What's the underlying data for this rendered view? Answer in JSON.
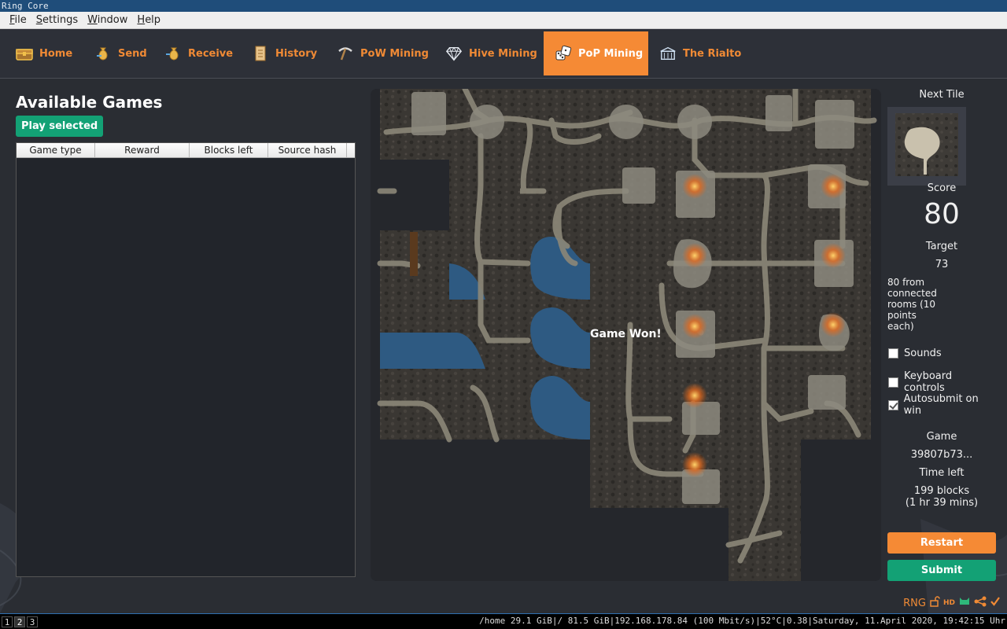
{
  "window": {
    "title": "Ring Core"
  },
  "menu": [
    {
      "label": "File",
      "underline": "F",
      "rest": "ile"
    },
    {
      "label": "Settings",
      "underline": "S",
      "rest": "ettings"
    },
    {
      "label": "Window",
      "underline": "W",
      "rest": "indow"
    },
    {
      "label": "Help",
      "underline": "H",
      "rest": "elp"
    }
  ],
  "tabs": [
    {
      "label": "Home",
      "icon": "treasure-chest-icon"
    },
    {
      "label": "Send",
      "icon": "money-bag-send-icon"
    },
    {
      "label": "Receive",
      "icon": "money-bag-receive-icon"
    },
    {
      "label": "History",
      "icon": "scroll-icon"
    },
    {
      "label": "PoW Mining",
      "icon": "pickaxe-icon"
    },
    {
      "label": "Hive Mining",
      "icon": "diamond-icon"
    },
    {
      "label": "PoP Mining",
      "icon": "dice-icon",
      "active": true
    },
    {
      "label": "The Rialto",
      "icon": "market-icon"
    }
  ],
  "games": {
    "title": "Available Games",
    "play_label": "Play selected",
    "columns": [
      "Game type",
      "Reward",
      "Blocks left",
      "Source hash"
    ],
    "rows": []
  },
  "board": {
    "status": "Game Won!"
  },
  "side": {
    "next_tile_label": "Next Tile",
    "score_label": "Score",
    "score": "80",
    "target_label": "Target",
    "target": "73",
    "description": "80 from connected rooms (10 points each)",
    "options": [
      {
        "label": "Sounds",
        "checked": false
      },
      {
        "label": "Keyboard controls",
        "checked": false
      },
      {
        "label": "Autosubmit on win",
        "checked": true
      }
    ],
    "game_label": "Game",
    "game_hash": "39807b73...",
    "time_left_label": "Time left",
    "blocks_left": "199 blocks",
    "time_left": "(1 hr 39 mins)",
    "restart_label": "Restart",
    "submit_label": "Submit"
  },
  "status": {
    "ticker": "RNG",
    "hd_label": "HD"
  },
  "taskbar": {
    "workspaces": [
      "1",
      "2",
      "3"
    ],
    "active_workspace": "2",
    "system": "/home 29.1 GiB|/ 81.5 GiB|192.168.178.84 (100 Mbit/s)|52°C|0.38|Saturday, 11.April 2020, 19:42:15 Uhr"
  },
  "colors": {
    "accent": "#f58a35",
    "primary_green": "#13a175",
    "background": "#2a2d33",
    "water": "#2e5a82"
  }
}
